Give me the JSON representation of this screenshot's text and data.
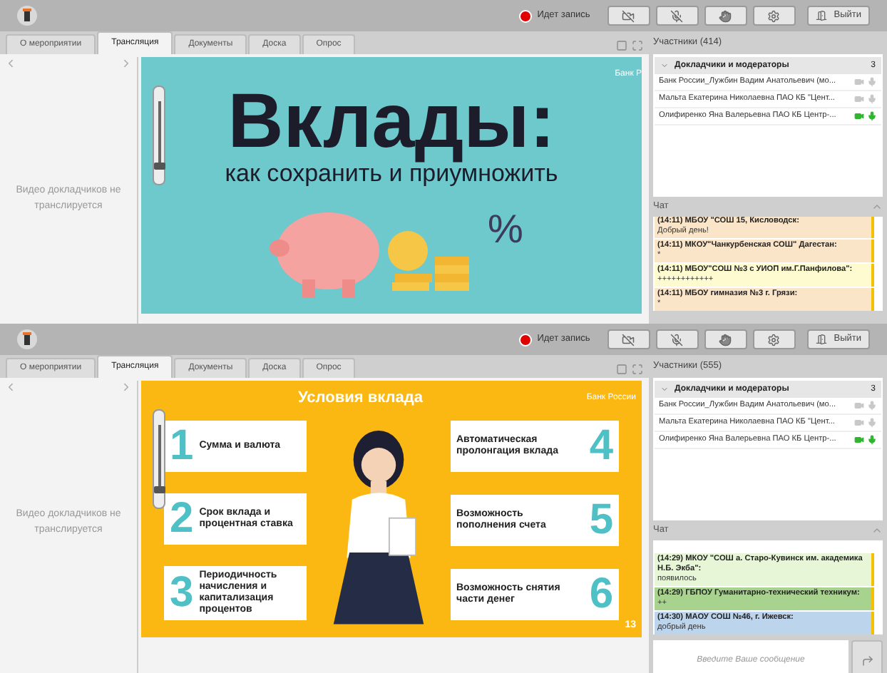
{
  "screens": [
    {
      "header": {
        "record_label": "Идет запись",
        "recording": true,
        "exit_label": "Выйти"
      },
      "tabs": [
        {
          "label": "О мероприятии",
          "selected": false
        },
        {
          "label": "Трансляция",
          "selected": true
        },
        {
          "label": "Документы",
          "selected": false
        },
        {
          "label": "Доска",
          "selected": false
        },
        {
          "label": "Опрос",
          "selected": false
        }
      ],
      "video_notice": "Видео докладчиков не транслируется",
      "zoom_slider": {
        "level": 0.05
      },
      "slide": {
        "kind": "cover",
        "bank_label": "Банк Р",
        "title": "Вклады:",
        "subtitle": "как сохранить и приумножить",
        "decor_symbol": "%"
      },
      "participants": {
        "title": "Участники (414)",
        "group": {
          "label": "Докладчики и модераторы",
          "count": "3",
          "expanded": true
        },
        "items": [
          {
            "name": "Банк России_Лужбин Вадим Анатольевич (мо...",
            "camera_on": false,
            "mic_on": false
          },
          {
            "name": "Мальта Екатерина Николаевна ПАО КБ \"Цент...",
            "camera_on": false,
            "mic_on": false
          },
          {
            "name": "Олифиренко Яна Валерьевна ПАО КБ Центр-...",
            "camera_on": true,
            "mic_on": true
          }
        ]
      },
      "chat": {
        "title": "Чат",
        "expanded": true,
        "messages": [
          {
            "sender": "(14:11) МБОУ \"СОШ 15, Кисловодск:",
            "text": "Добрый день!",
            "color": "#fbe5c8"
          },
          {
            "sender": "(14:11) МКОУ\"Чанкурбенская СОШ\" Дагестан:",
            "text": "*",
            "color": "#fbe5c8"
          },
          {
            "sender": "(14:11) МБОУ\"СОШ №3 с УИОП им.Г.Панфилова\":",
            "text": "++++++++++++",
            "color": "#fdfbcf"
          },
          {
            "sender": "(14:11) МБОУ гимназия №3 г. Грязи:",
            "text": "*",
            "color": "#fbe5c8"
          }
        ]
      }
    },
    {
      "header": {
        "record_label": "Идет запись",
        "recording": true,
        "exit_label": "Выйти"
      },
      "tabs": [
        {
          "label": "О мероприятии",
          "selected": false
        },
        {
          "label": "Трансляция",
          "selected": true
        },
        {
          "label": "Документы",
          "selected": false
        },
        {
          "label": "Доска",
          "selected": false
        },
        {
          "label": "Опрос",
          "selected": false
        }
      ],
      "video_notice": "Видео докладчиков не транслируется",
      "zoom_slider": {
        "level": 0.05
      },
      "slide": {
        "kind": "conditions",
        "bank_label": "Банк России",
        "title": "Условия вклада",
        "page": "13",
        "items": [
          {
            "number": "1",
            "label": "Сумма и валюта"
          },
          {
            "number": "2",
            "label": "Срок вклада и процентная ставка"
          },
          {
            "number": "3",
            "label": "Периодичность начисления и капитализация процентов"
          },
          {
            "number": "4",
            "label": "Автоматическая пролонгация вклада"
          },
          {
            "number": "5",
            "label": "Возможность пополнения счета"
          },
          {
            "number": "6",
            "label": "Возможность снятия части денег"
          }
        ]
      },
      "participants": {
        "title": "Участники (555)",
        "group": {
          "label": "Докладчики и модераторы",
          "count": "3",
          "expanded": true
        },
        "items": [
          {
            "name": "Банк России_Лужбин Вадим Анатольевич (мо...",
            "camera_on": false,
            "mic_on": false
          },
          {
            "name": "Мальта Екатерина Николаевна ПАО КБ \"Цент...",
            "camera_on": false,
            "mic_on": false
          },
          {
            "name": "Олифиренко Яна Валерьевна ПАО КБ Центр-...",
            "camera_on": true,
            "mic_on": true
          }
        ]
      },
      "chat": {
        "title": "Чат",
        "expanded": true,
        "messages": [
          {
            "sender": "(14:29) МКОУ \"СОШ а. Старо-Кувинск им. академика Н.Б. Экба\":",
            "text": "появилось",
            "color": "#e6f6d6"
          },
          {
            "sender": "(14:29) ГБПОУ Гуманитарно-технический техникум:",
            "text": "++",
            "color": "#a8d38e"
          },
          {
            "sender": "(14:30) МАОУ СОШ №46, г. Ижевск:",
            "text": "добрый день",
            "color": "#bcd4ec"
          }
        ]
      },
      "message_input": {
        "placeholder": "Введите Ваше сообщение"
      }
    }
  ]
}
